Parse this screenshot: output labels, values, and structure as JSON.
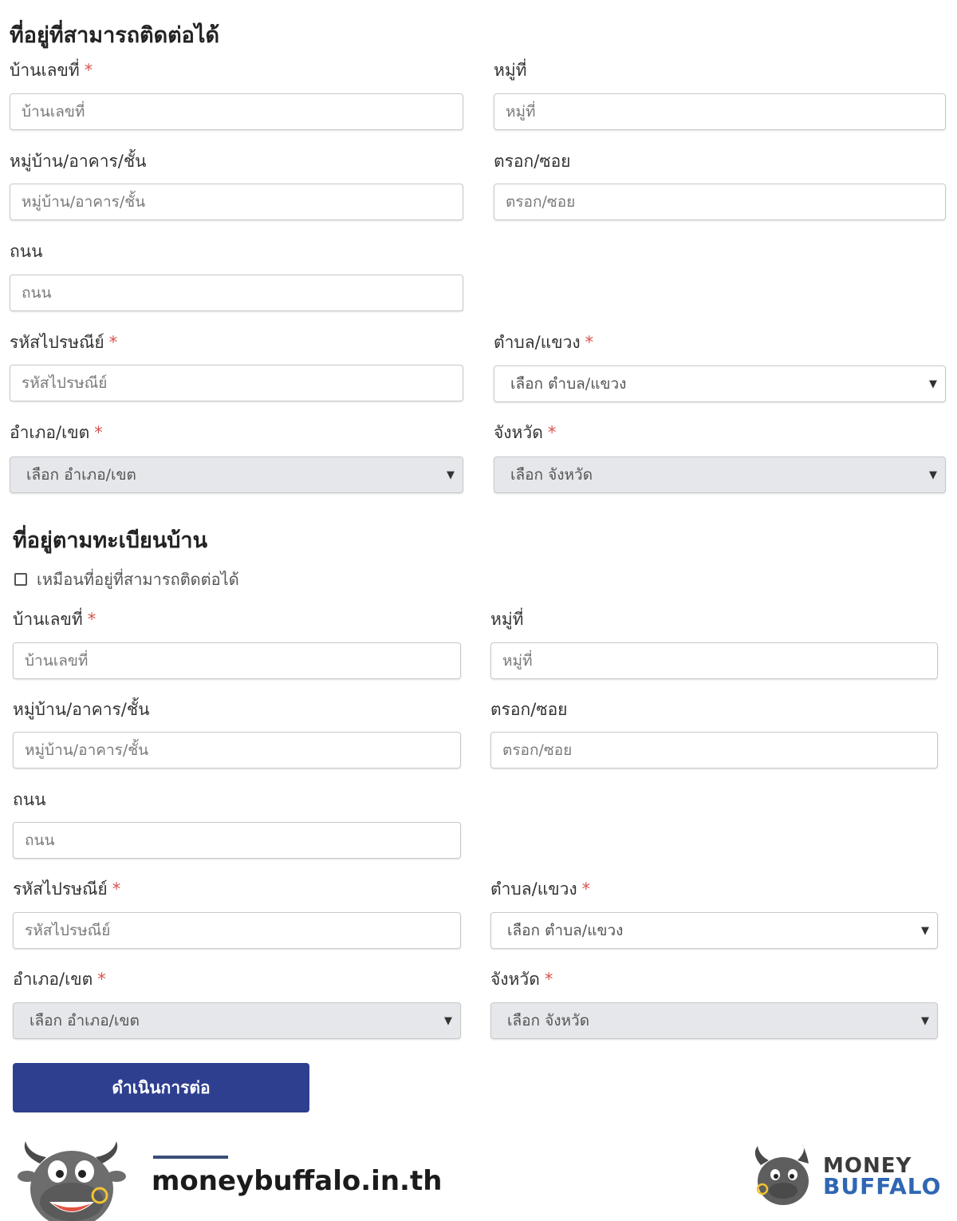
{
  "contact_section": {
    "title": "ที่อยู่ที่สามารถติดต่อได้",
    "house_no": {
      "label": "บ้านเลขที่",
      "placeholder": "บ้านเลขที่"
    },
    "moo": {
      "label": "หมู่ที่",
      "placeholder": "หมู่ที่"
    },
    "village": {
      "label": "หมู่บ้าน/อาคาร/ชั้น",
      "placeholder": "หมู่บ้าน/อาคาร/ชั้น"
    },
    "soi": {
      "label": "ตรอก/ซอย",
      "placeholder": "ตรอก/ซอย"
    },
    "road": {
      "label": "ถนน",
      "placeholder": "ถนน"
    },
    "postal": {
      "label": "รหัสไปรษณีย์",
      "placeholder": "รหัสไปรษณีย์"
    },
    "subdistrict": {
      "label": "ตำบล/แขวง",
      "value": "เลือก ตำบล/แขวง"
    },
    "district": {
      "label": "อำเภอ/เขต",
      "value": "เลือก อำเภอ/เขต"
    },
    "province": {
      "label": "จังหวัด",
      "value": "เลือก จังหวัด"
    }
  },
  "registered_section": {
    "title": "ที่อยู่ตามทะเบียนบ้าน",
    "same_as_contact": "เหมือนที่อยู่ที่สามารถติดต่อได้",
    "house_no": {
      "label": "บ้านเลขที่",
      "placeholder": "บ้านเลขที่"
    },
    "moo": {
      "label": "หมู่ที่",
      "placeholder": "หมู่ที่"
    },
    "village": {
      "label": "หมู่บ้าน/อาคาร/ชั้น",
      "placeholder": "หมู่บ้าน/อาคาร/ชั้น"
    },
    "soi": {
      "label": "ตรอก/ซอย",
      "placeholder": "ตรอก/ซอย"
    },
    "road": {
      "label": "ถนน",
      "placeholder": "ถนน"
    },
    "postal": {
      "label": "รหัสไปรษณีย์",
      "placeholder": "รหัสไปรษณีย์"
    },
    "subdistrict": {
      "label": "ตำบล/แขวง",
      "value": "เลือก ตำบล/แขวง"
    },
    "district": {
      "label": "อำเภอ/เขต",
      "value": "เลือก อำเภอ/เขต"
    },
    "province": {
      "label": "จังหวัด",
      "value": "เลือก จังหวัด"
    }
  },
  "required_mark": "*",
  "caret": "▼",
  "continue_button": "ดำเนินการต่อ",
  "footer": {
    "site": "moneybuffalo.in.th",
    "brand_line1": "MONEY",
    "brand_line2": "BUFFALO"
  },
  "colors": {
    "primary_button": "#2e3f8f",
    "required": "#d9534f",
    "disabled_select": "#e5e7ea",
    "brand_blue": "#2f67b3"
  }
}
